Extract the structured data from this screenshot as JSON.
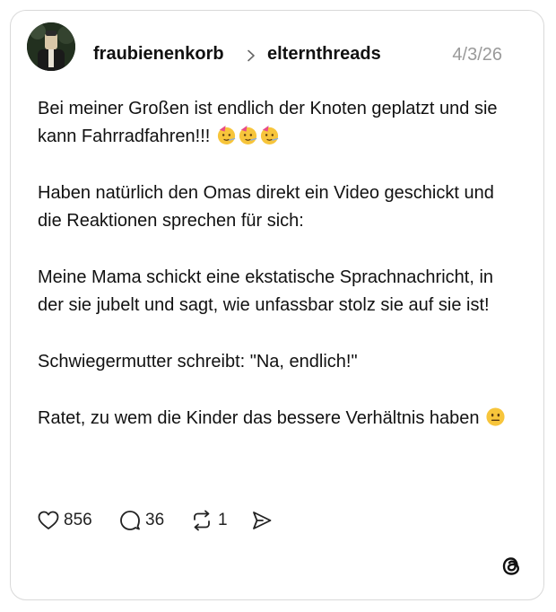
{
  "post": {
    "author": "fraubienenkorb",
    "community": "elternthreads",
    "date": "4/3/26",
    "paragraphs": {
      "p1": "Bei meiner Großen ist endlich der Knoten geplatzt und sie kann Fahrradfahren!!!",
      "p2": "Haben natürlich den Omas direkt ein Video geschickt und die Reaktionen sprechen für sich:",
      "p3": "Meine Mama schickt eine ekstatische Sprachnachricht, in der sie jubelt und sagt, wie unfassbar stolz sie auf sie ist!",
      "p4": "Schwiegermutter schreibt: \"Na, endlich!\"",
      "p5": "Ratet, zu wem die Kinder das bessere Verhältnis haben"
    },
    "emojis": {
      "p1": [
        "partying-face",
        "partying-face",
        "partying-face"
      ],
      "p5": [
        "neutral-face"
      ]
    }
  },
  "actions": {
    "likes": "856",
    "replies": "36",
    "reposts": "1"
  },
  "icons": {
    "like": "heart-icon",
    "reply": "speech-bubble-icon",
    "repost": "repost-icon",
    "share": "send-icon",
    "brand": "threads-logo-icon"
  },
  "colors": {
    "text": "#111111",
    "date": "#9a9a9a",
    "border": "#d9d9d9",
    "emoji_yellow": "#f7c53b"
  }
}
